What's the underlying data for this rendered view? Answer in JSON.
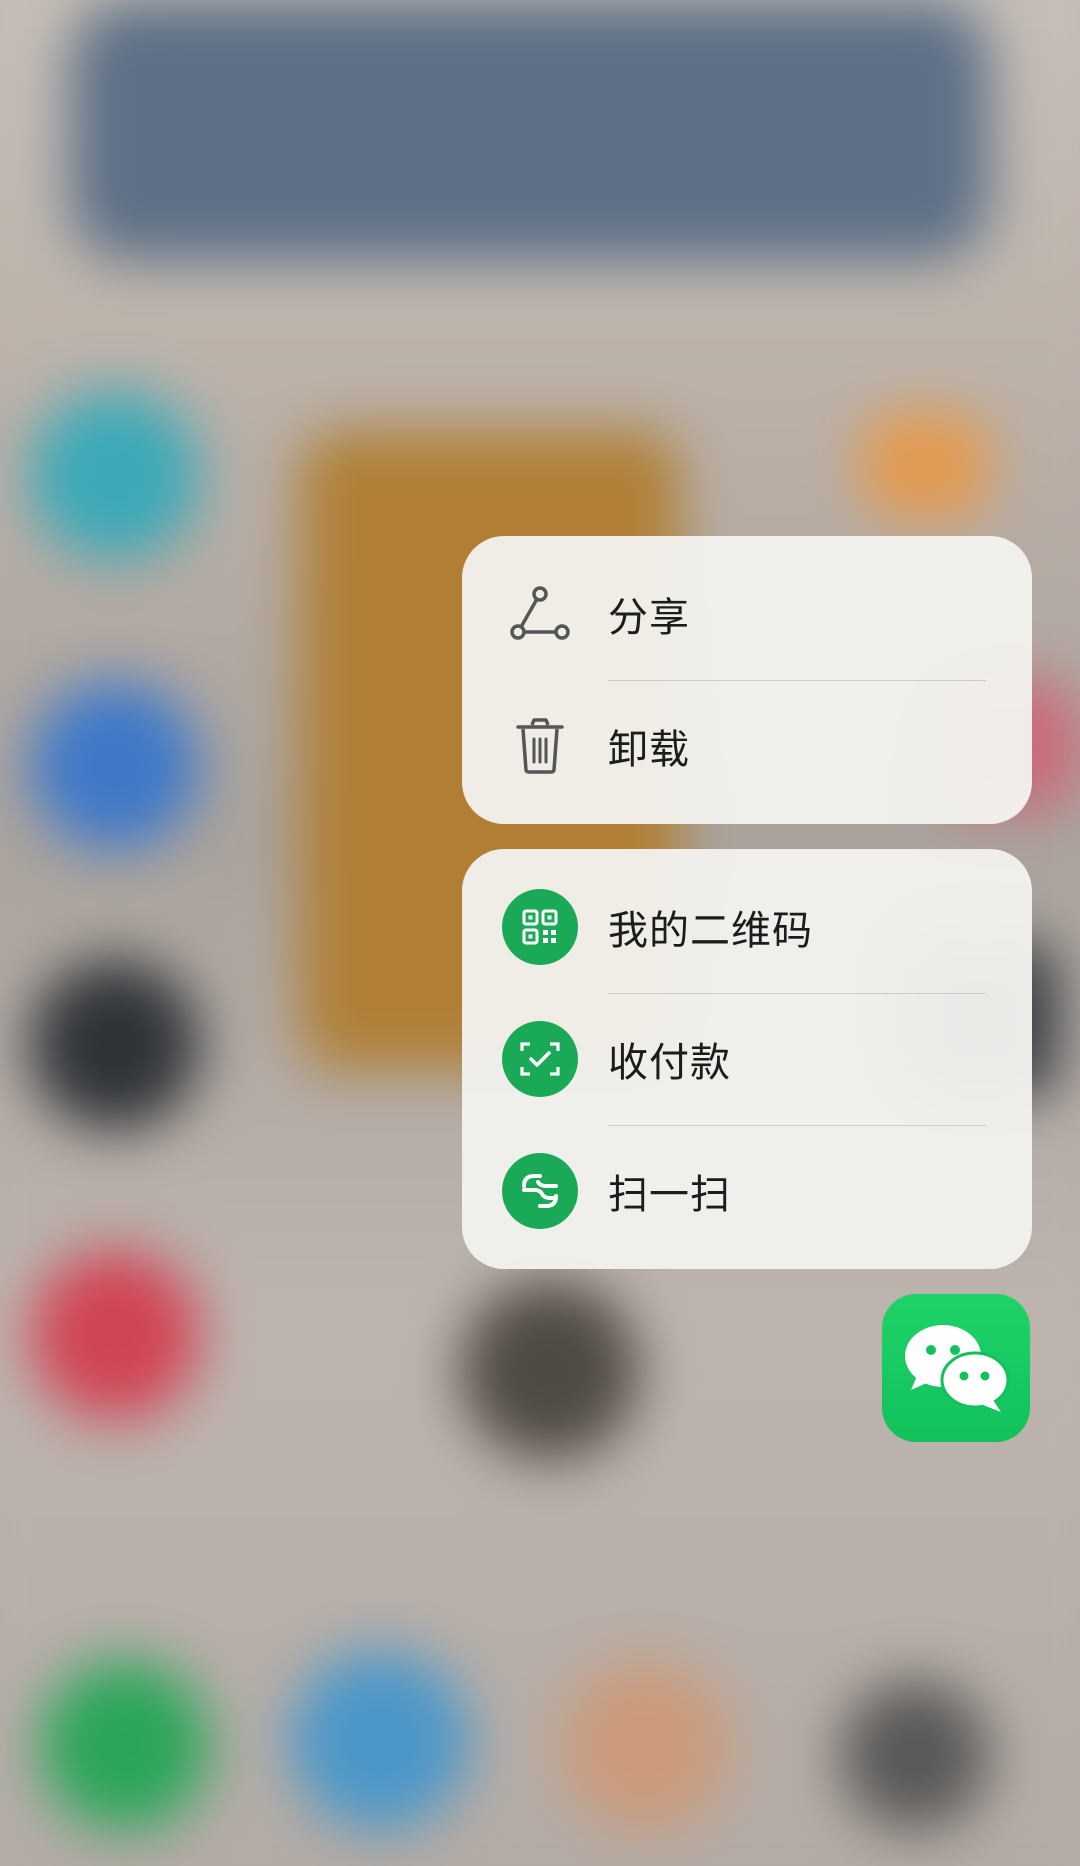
{
  "context_menu": {
    "system_actions": [
      {
        "label": "分享",
        "icon": "share-icon"
      },
      {
        "label": "卸载",
        "icon": "trash-icon"
      }
    ],
    "app_actions": [
      {
        "label": "我的二维码",
        "icon": "qr-code-icon"
      },
      {
        "label": "收付款",
        "icon": "payment-icon"
      },
      {
        "label": "扫一扫",
        "icon": "scan-icon"
      }
    ]
  },
  "app": {
    "icon": "wechat-app-icon"
  },
  "colors": {
    "menu_background": "#f3f1ee",
    "icon_green": "#1aaa57",
    "app_icon_green": "#12c15a",
    "text": "#1c1c1c"
  }
}
